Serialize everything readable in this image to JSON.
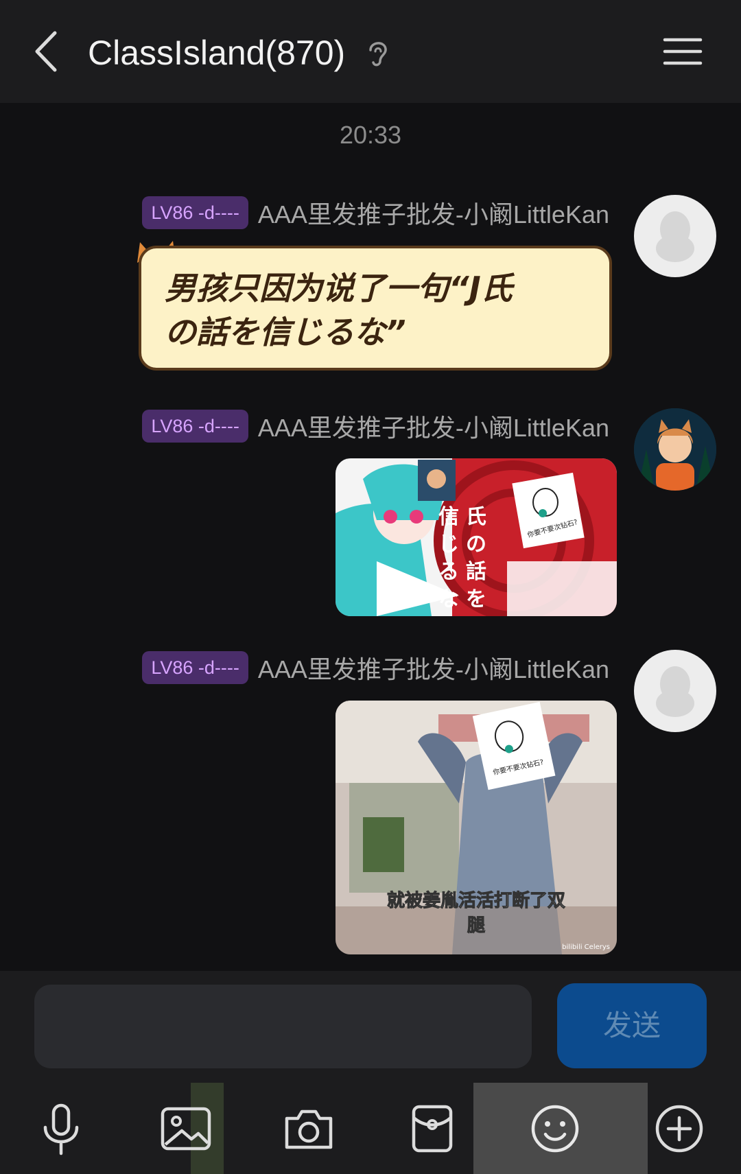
{
  "header": {
    "title": "ClassIsland(870)"
  },
  "chat": {
    "timestamp": "20:33",
    "messages": [
      {
        "badge": "LV86 -d----",
        "sender": "AAA里发推子批发-小阚LittleKan",
        "sticker_text": "男孩只因为说了一句“J氏\nの話を信じるな”"
      },
      {
        "badge": "LV86 -d----",
        "sender": "AAA里发推子批发-小阚LittleKan",
        "image_text": [
          "信",
          "じ",
          "る",
          "な",
          "氏",
          "の",
          "話",
          "を"
        ],
        "image_caption": "你要不要次钻石?"
      },
      {
        "badge": "LV86 -d----",
        "sender": "AAA里发推子批发-小阚LittleKan",
        "image_caption_1": "就被姜胤活活打断了双",
        "image_caption_2": "腿",
        "image_sign": "你要不要次钻石?",
        "watermark": "bilibili  Celerys"
      }
    ]
  },
  "input": {
    "placeholder": "",
    "send_label": "发送"
  },
  "toolbar": {
    "items": [
      "microphone-icon",
      "gallery-icon",
      "camera-icon",
      "red-packet-icon",
      "emoji-icon",
      "plus-icon"
    ]
  }
}
